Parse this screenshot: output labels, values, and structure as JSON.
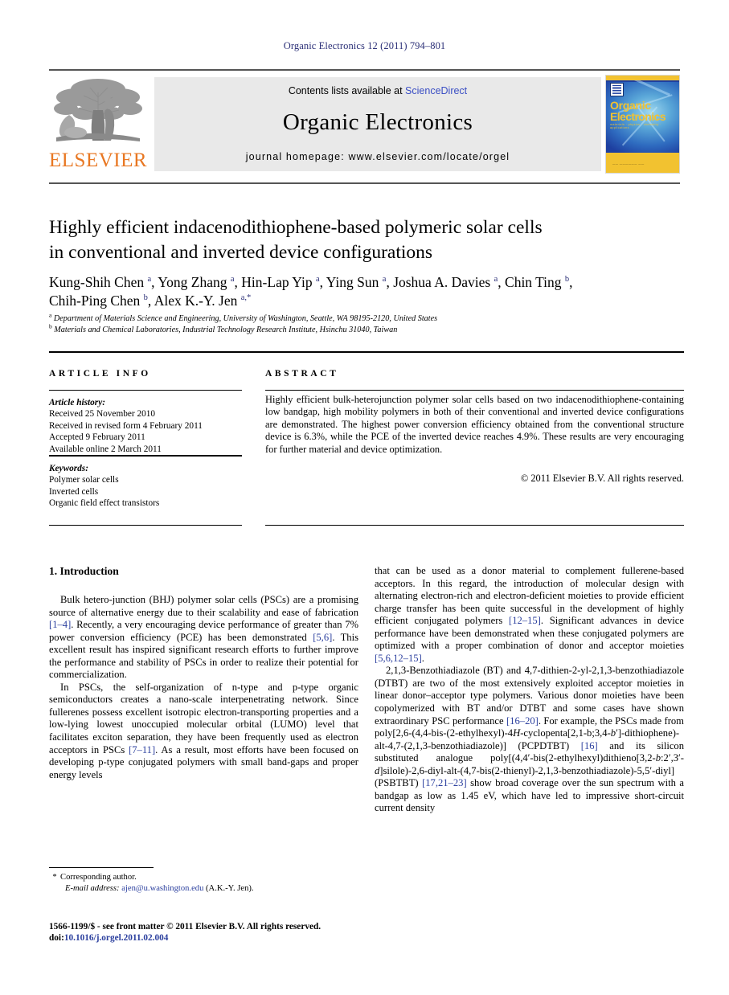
{
  "running_head": "Organic Electronics 12 (2011) 794–801",
  "masthead": {
    "publisher_name": "ELSEVIER",
    "contents_prefix": "Contents lists available at ",
    "contents_link": "ScienceDirect",
    "journal_title": "Organic Electronics",
    "homepage": "journal homepage: www.elsevier.com/locate/orgel",
    "cover": {
      "line1": "Organic",
      "line2": "Electronics",
      "subtitle": "materials · physics · chemistry · applications",
      "footer": "——  ——————  ——"
    }
  },
  "article": {
    "title_line1": "Highly efficient indacenodithiophene-based polymeric solar cells",
    "title_line2": "in conventional and inverted device configurations",
    "authors_line1": "Kung-Shih Chen <sup>a</sup>, Yong Zhang <sup>a</sup>, Hin-Lap Yip <sup>a</sup>, Ying Sun <sup>a</sup>, Joshua A. Davies <sup>a</sup>, Chin Ting <sup>b</sup>,",
    "authors_line2": "Chih-Ping Chen <sup>b</sup>, Alex K.-Y. Jen <sup>a,*</sup>",
    "affiliation_a": "<sup>a</sup> Department of Materials Science and Engineering, University of Washington, Seattle, WA 98195-2120, United States",
    "affiliation_b": "<sup>b</sup> Materials and Chemical Laboratories, Industrial Technology Research Institute, Hsinchu 31040, Taiwan"
  },
  "info": {
    "section_label": "ARTICLE INFO",
    "history_heading": "Article history:",
    "history": [
      "Received 25 November 2010",
      "Received in revised form 4 February 2011",
      "Accepted 9 February 2011",
      "Available online 2 March 2011"
    ],
    "keywords_heading": "Keywords:",
    "keywords": [
      "Polymer solar cells",
      "Inverted cells",
      "Organic field effect transistors"
    ]
  },
  "abstract": {
    "section_label": "ABSTRACT",
    "text": "Highly efficient bulk-heterojunction polymer solar cells based on two indacenodithiophene-containing low bandgap, high mobility polymers in both of their conventional and inverted device configurations are demonstrated. The highest power conversion efficiency obtained from the conventional structure device is 6.3%, while the PCE of the inverted device reaches 4.9%. These results are very encouraging for further material and device optimization.",
    "copyright": "© 2011 Elsevier B.V. All rights reserved."
  },
  "body": {
    "intro_heading": "1. Introduction",
    "left_paragraphs": [
      "Bulk hetero-junction (BHJ) polymer solar cells (PSCs) are a promising source of alternative energy due to their scalability and ease of fabrication <span class=\"ref\">[1–4]</span>. Recently, a very encouraging device performance of greater than 7% power conversion efficiency (PCE) has been demonstrated <span class=\"ref\">[5,6]</span>. This excellent result has inspired significant research efforts to further improve the performance and stability of PSCs in order to realize their potential for commercialization.",
      "In PSCs, the self-organization of n-type and p-type organic semiconductors creates a nano-scale interpenetrating network. Since fullerenes possess excellent isotropic electron-transporting properties and a low-lying lowest unoccupied molecular orbital (LUMO) level that facilitates exciton separation, they have been frequently used as electron acceptors in PSCs <span class=\"ref\">[7–11]</span>. As a result, most efforts have been focused on developing p-type conjugated polymers with small band-gaps and proper energy levels"
    ],
    "right_paragraphs": [
      "that can be used as a donor material to complement fullerene-based acceptors. In this regard, the introduction of molecular design with alternating electron-rich and electron-deficient moieties to provide efficient charge transfer has been quite successful in the development of highly efficient conjugated polymers <span class=\"ref\">[12–15]</span>. Significant advances in device performance have been demonstrated when these conjugated polymers are optimized with a proper combination of donor and acceptor moieties <span class=\"ref\">[5,6,12–15]</span>.",
      "2,1,3-Benzothiadiazole (BT) and 4,7-dithien-2-yl-2,1,3-benzothiadiazole (DTBT) are two of the most extensively exploited acceptor moieties in linear donor–acceptor type polymers. Various donor moieties have been copolymerized with BT and/or DTBT and some cases have shown extraordinary PSC performance <span class=\"ref\">[16–20]</span>. For example, the PSCs made from poly[2,6-(4,4-bis-(2-ethylhexyl)-4<i>H</i>-cyclopenta[2,1-b;3,4-<i>b</i>′]-dithiophene)-alt-4,7-(2,1,3-benzothiadiazole)] (PCPDTBT) <span class=\"ref\">[16]</span> and its silicon substituted analogue poly[(4,4′-bis(2-ethylhexyl)dithieno[3,2-<i>b</i>:2′,3′-<i>d</i>]silole)-2,6-diyl-alt-(4,7-bis(2-thienyl)-2,1,3-benzothiadiazole)-5,5′-diyl] (PSBTBT) <span class=\"ref\">[17,21–23]</span> show broad coverage over the sun spectrum with a bandgap as low as 1.45 eV, which have led to impressive short-circuit current density"
    ]
  },
  "footer": {
    "corresponding_marker": "*",
    "corresponding_text": "Corresponding author.",
    "email_label": "E-mail address:",
    "email": "ajen@u.washington.edu",
    "email_attrib": "(A.K.-Y. Jen).",
    "imprint_line1": "1566-1199/$ - see front matter © 2011 Elsevier B.V. All rights reserved.",
    "doi_label": "doi:",
    "doi_value": "10.1016/j.orgel.2011.02.004"
  },
  "colors": {
    "running_head": "#2b2f77",
    "link": "#3a4ec4",
    "reference": "#2b3f9e",
    "elsevier_orange": "#E87722",
    "banner_bg": "#e9e9e9",
    "cover_blue": "#1e3fa0",
    "cover_yellow": "#f2c230"
  }
}
